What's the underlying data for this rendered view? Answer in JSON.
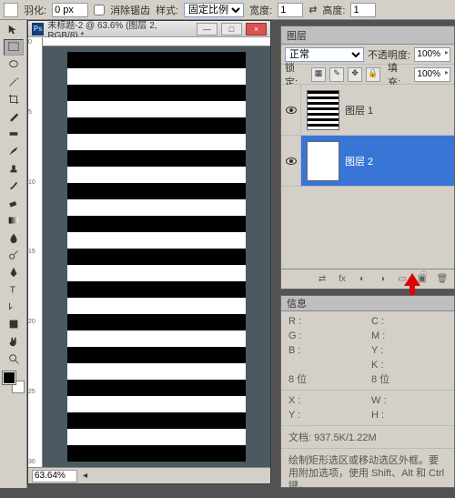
{
  "options": {
    "feather_label": "羽化:",
    "feather_value": "0 px",
    "antialias_label": "消除锯齿",
    "style_label": "样式:",
    "style_value": "固定比例",
    "width_label": "宽度:",
    "width_value": "1",
    "height_label": "高度:",
    "height_value": "1"
  },
  "document": {
    "title": "未标题-2 @ 63.6% (图层 2, RGB/8) *",
    "zoom": "63.64%"
  },
  "layers": {
    "tab": "图层",
    "blend_mode": "正常",
    "opacity_label": "不透明度:",
    "opacity_value": "100%",
    "lock_label": "锁定:",
    "fill_label": "填充:",
    "fill_value": "100%",
    "items": [
      {
        "name": "图层 1"
      },
      {
        "name": "图层 2"
      }
    ]
  },
  "info": {
    "tab": "信息",
    "r": "R :",
    "g": "G :",
    "b": "B :",
    "c": "C :",
    "m": "M :",
    "y": "Y :",
    "k": "K :",
    "bits_left": "8 位",
    "bits_right": "8 位",
    "x": "X :",
    "yy": "Y :",
    "w": "W :",
    "h": "H :",
    "doc_label": "文档:",
    "doc_value": "937.5K/1.22M",
    "hint": "绘制矩形选区或移动选区外框。要用附加选项，使用 Shift、Alt 和 Ctrl 键。"
  }
}
